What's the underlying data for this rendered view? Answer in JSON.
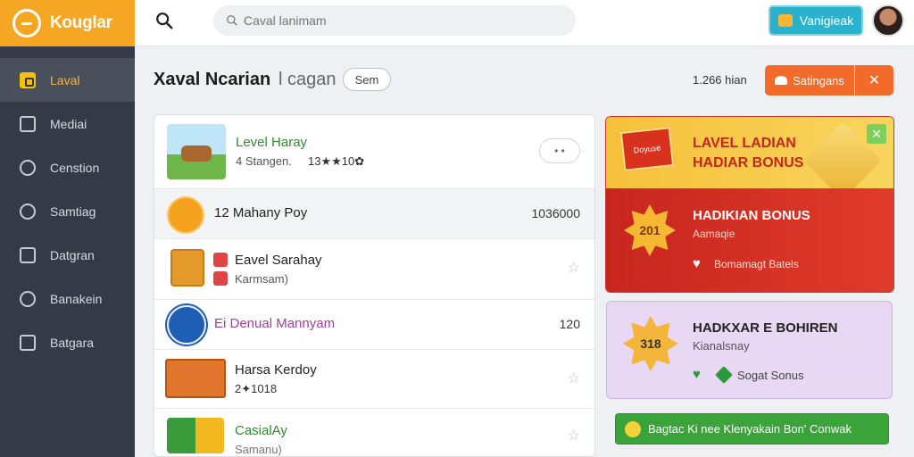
{
  "app": {
    "name": "Kouglar"
  },
  "sidebar": {
    "items": [
      {
        "label": "Laval",
        "icon": "coupon-icon",
        "active": true
      },
      {
        "label": "Mediai",
        "icon": "camera-icon"
      },
      {
        "label": "Censtion",
        "icon": "user-icon"
      },
      {
        "label": "Samtiag",
        "icon": "user-icon"
      },
      {
        "label": "Datgran",
        "icon": "document-icon"
      },
      {
        "label": "Banakein",
        "icon": "badge-icon"
      },
      {
        "label": "Batgara",
        "icon": "briefcase-icon"
      }
    ]
  },
  "topbar": {
    "search_placeholder": "Caval lanimam",
    "navigate_label": "Vanigieak"
  },
  "header": {
    "title": "Xaval Ncarian",
    "subtitle": "l cagan",
    "chip": "Sem",
    "count": "1.266 hian",
    "settings_label": "Satingans",
    "close_label": "✕"
  },
  "list": {
    "items": [
      {
        "title": "Level Haray",
        "sub": "4 Stangen.",
        "rating": "13★★10✿",
        "action": "• •"
      },
      {
        "title": "12  Mahany Poy",
        "value": "1036000"
      },
      {
        "title": "Eavel Sarahay",
        "sub": "Karmsam)",
        "action": "☆"
      },
      {
        "title": "Ei  Denual Mannyam",
        "value": "120"
      },
      {
        "title": "Harsa Kerdoy",
        "sub": "2✦1018",
        "action": "☆"
      },
      {
        "title": "CasialAy",
        "sub": "Samanu)",
        "action": "☆"
      }
    ]
  },
  "promo1": {
    "title": "LAVEL LADIAN HADIAR BONUS",
    "badge": "Doyuse",
    "card_title": "HADIKIAN BONUS",
    "card_sub": "Aamaqie",
    "card_link": "Bomamagt Batels",
    "seal": "201"
  },
  "promo2": {
    "title": "HADKXAR E BOHIREN",
    "sub": "Kianalsnay",
    "link": "Sogat Sonus",
    "seal": "318"
  },
  "bottom_button": {
    "label": "Bagtac Ki nee Klenyakain Bon' Conwak"
  },
  "colors": {
    "brand": "#f5a623",
    "sidebar": "#343a46",
    "accent": "#f26b2a",
    "teal": "#2ab1cc",
    "green": "#3aa33a"
  }
}
